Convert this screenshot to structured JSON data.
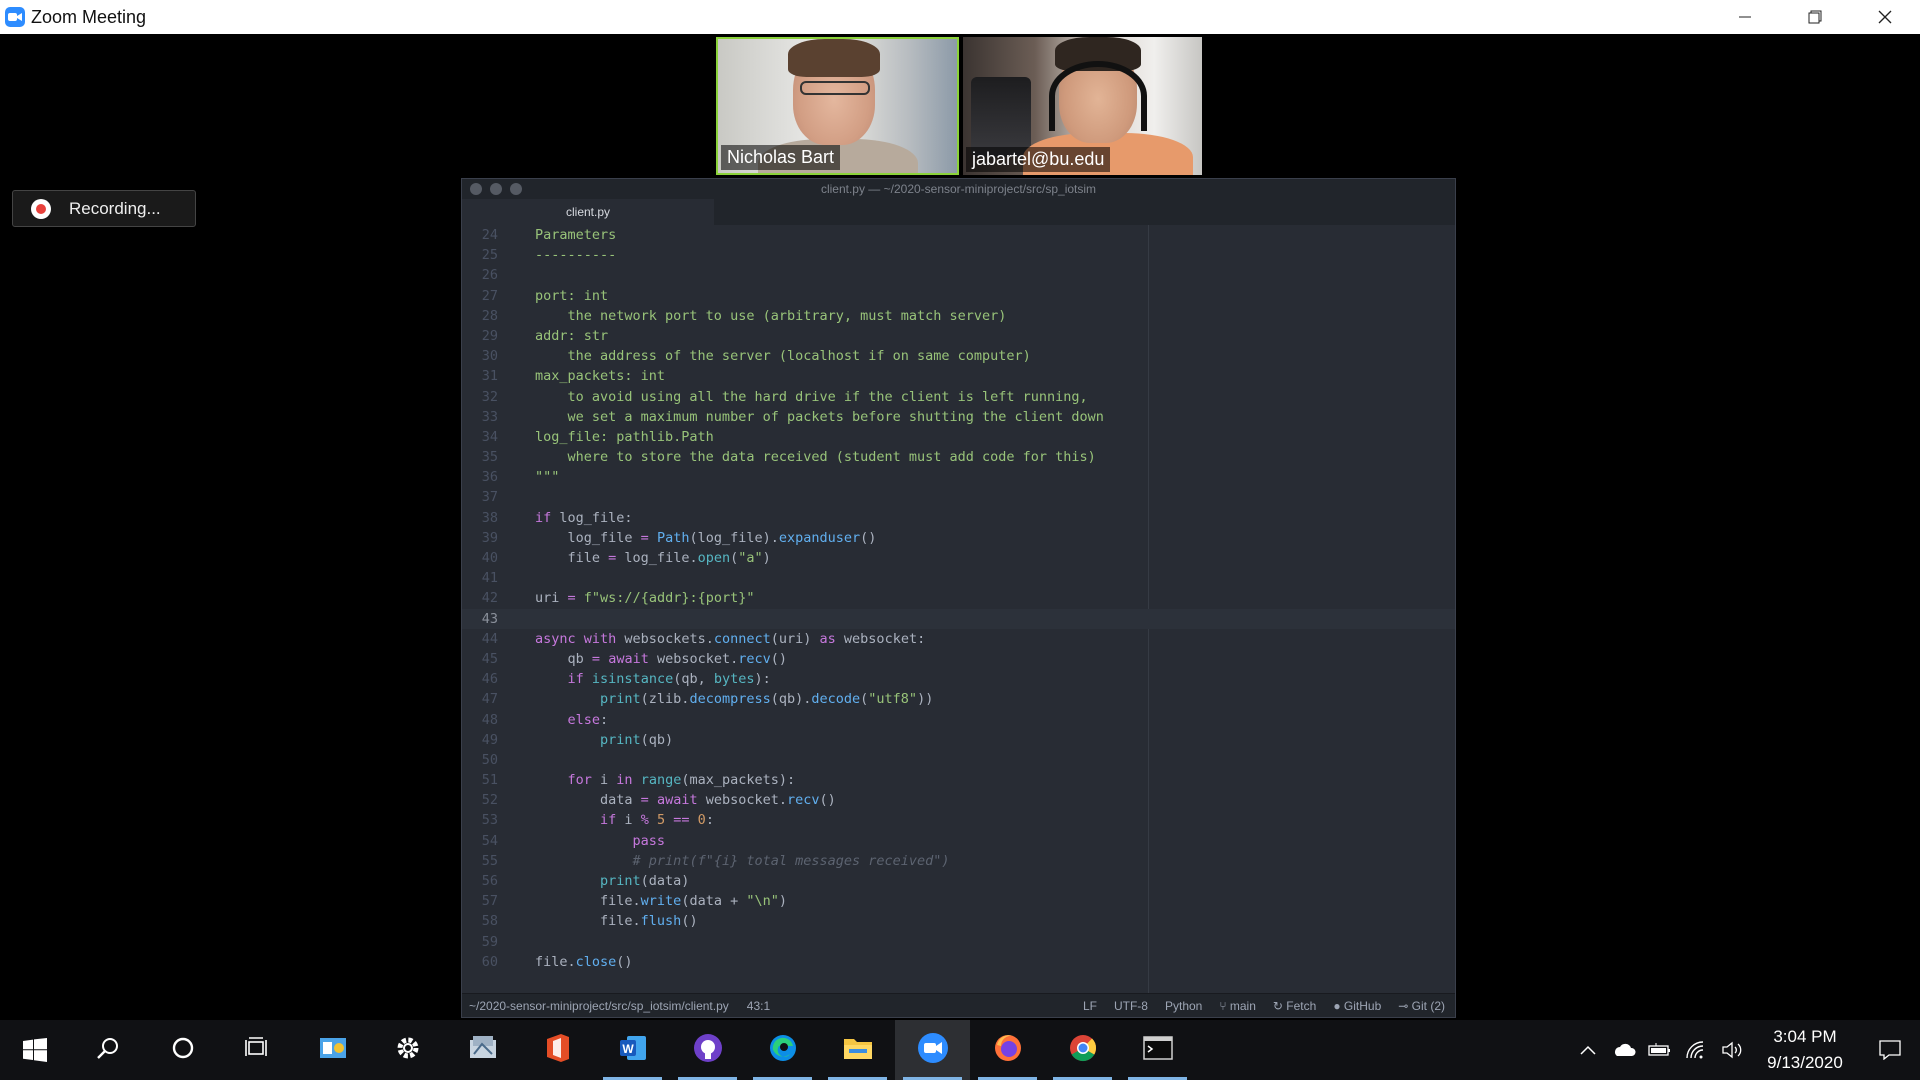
{
  "window": {
    "title": "Zoom Meeting",
    "controls": [
      "minimize",
      "restore",
      "close"
    ]
  },
  "participants": [
    {
      "name": "Nicholas Bart",
      "active_speaker": true
    },
    {
      "name": "jabartel@bu.edu",
      "active_speaker": false
    }
  ],
  "recording": {
    "label": "Recording..."
  },
  "editor": {
    "title": "client.py — ~/2020-sensor-miniproject/src/sp_iotsim",
    "tab": "client.py",
    "current_line": 43,
    "status": {
      "path": "~/2020-sensor-miniproject/src/sp_iotsim/client.py",
      "cursor": "43:1",
      "line_ending": "LF",
      "encoding": "UTF-8",
      "grammar": "Python",
      "branch": "main",
      "fetch": "Fetch",
      "github": "GitHub",
      "git": "Git (2)"
    },
    "lines": [
      {
        "n": "24",
        "t": "    Parameters"
      },
      {
        "n": "25",
        "t": "    ----------"
      },
      {
        "n": "26",
        "t": ""
      },
      {
        "n": "27",
        "t": "    port: int"
      },
      {
        "n": "28",
        "t": "        the network port to use (arbitrary, must match server)"
      },
      {
        "n": "29",
        "t": "    addr: str"
      },
      {
        "n": "30",
        "t": "        the address of the server (localhost if on same computer)"
      },
      {
        "n": "31",
        "t": "    max_packets: int"
      },
      {
        "n": "32",
        "t": "        to avoid using all the hard drive if the client is left running,"
      },
      {
        "n": "33",
        "t": "        we set a maximum number of packets before shutting the client down"
      },
      {
        "n": "34",
        "t": "    log_file: pathlib.Path"
      },
      {
        "n": "35",
        "t": "        where to store the data received (student must add code for this)"
      },
      {
        "n": "36",
        "t": "    \"\"\""
      },
      {
        "n": "37",
        "t": ""
      },
      {
        "n": "38",
        "t": "    if log_file:"
      },
      {
        "n": "39",
        "t": "        log_file = Path(log_file).expanduser()"
      },
      {
        "n": "40",
        "t": "        file = log_file.open(\"a\")"
      },
      {
        "n": "41",
        "t": ""
      },
      {
        "n": "42",
        "t": "    uri = f\"ws://{addr}:{port}\""
      },
      {
        "n": "43",
        "t": ""
      },
      {
        "n": "44",
        "t": "    async with websockets.connect(uri) as websocket:"
      },
      {
        "n": "45",
        "t": "        qb = await websocket.recv()"
      },
      {
        "n": "46",
        "t": "        if isinstance(qb, bytes):"
      },
      {
        "n": "47",
        "t": "            print(zlib.decompress(qb).decode(\"utf8\"))"
      },
      {
        "n": "48",
        "t": "        else:"
      },
      {
        "n": "49",
        "t": "            print(qb)"
      },
      {
        "n": "50",
        "t": ""
      },
      {
        "n": "51",
        "t": "        for i in range(max_packets):"
      },
      {
        "n": "52",
        "t": "            data = await websocket.recv()"
      },
      {
        "n": "53",
        "t": "            if i % 5 == 0:"
      },
      {
        "n": "54",
        "t": "                pass"
      },
      {
        "n": "55",
        "t": "                # print(f\"{i} total messages received\")"
      },
      {
        "n": "56",
        "t": "            print(data)"
      },
      {
        "n": "57",
        "t": "            file.write(data + \"\\n\")"
      },
      {
        "n": "58",
        "t": "            file.flush()"
      },
      {
        "n": "59",
        "t": ""
      },
      {
        "n": "60",
        "t": "    file.close()"
      }
    ]
  },
  "taskbar": {
    "apps": [
      {
        "name": "search-icon",
        "running": false
      },
      {
        "name": "cortana-icon",
        "running": false
      },
      {
        "name": "task-view-icon",
        "running": false
      },
      {
        "name": "control-panel-icon",
        "running": false
      },
      {
        "name": "settings-icon",
        "running": false
      },
      {
        "name": "explorer-tool-icon",
        "running": false
      },
      {
        "name": "office-icon",
        "running": false
      },
      {
        "name": "word-icon",
        "running": true
      },
      {
        "name": "github-desktop-icon",
        "running": true
      },
      {
        "name": "edge-icon",
        "running": true
      },
      {
        "name": "file-explorer-icon",
        "running": true
      },
      {
        "name": "zoom-icon",
        "running": true
      },
      {
        "name": "firefox-icon",
        "running": true
      },
      {
        "name": "chrome-icon",
        "running": true
      },
      {
        "name": "terminal-icon",
        "running": true
      }
    ],
    "clock": {
      "time": "3:04 PM",
      "date": "9/13/2020"
    }
  },
  "colors": {
    "zoom_blue": "#2d8cff",
    "active_speaker": "#8bd23a",
    "editor_bg": "#282c34",
    "recording_red": "#e8413c"
  }
}
